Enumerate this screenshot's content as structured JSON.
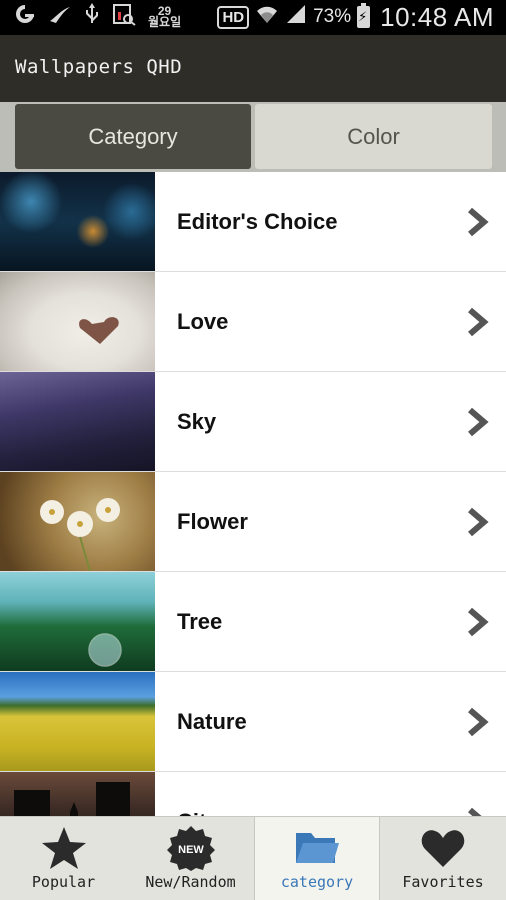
{
  "status_bar": {
    "calendar_badge": "29\n월요일",
    "hd_label": "HD",
    "battery_percent": "73%",
    "time": "10:48 AM"
  },
  "app": {
    "title": "Wallpapers QHD"
  },
  "tabs": [
    {
      "label": "Category",
      "selected": true
    },
    {
      "label": "Color",
      "selected": false
    }
  ],
  "categories": [
    {
      "label": "Editor's Choice"
    },
    {
      "label": "Love"
    },
    {
      "label": "Sky"
    },
    {
      "label": "Flower"
    },
    {
      "label": "Tree"
    },
    {
      "label": "Nature"
    },
    {
      "label": "City"
    }
  ],
  "bottom_nav": [
    {
      "label": "Popular",
      "icon": "star-icon",
      "selected": false
    },
    {
      "label": "New/Random",
      "icon": "new-badge-icon",
      "badge": "NEW",
      "selected": false
    },
    {
      "label": "category",
      "icon": "folder-icon",
      "selected": true
    },
    {
      "label": "Favorites",
      "icon": "heart-icon",
      "selected": false
    }
  ],
  "colors": {
    "app_bar": "#2e2d28",
    "tab_selected": "#4a4a42",
    "tab_unselected": "#d9d9d1",
    "nav_selected_accent": "#3a78b8"
  }
}
